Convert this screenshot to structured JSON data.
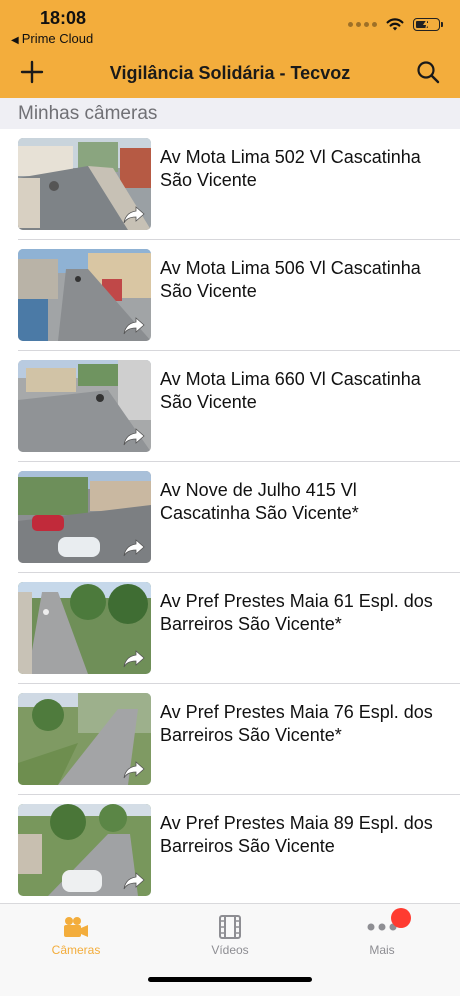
{
  "colors": {
    "accent": "#f3ad3c",
    "badge": "#ff3b30"
  },
  "status_bar": {
    "time": "18:08",
    "back_app": "Prime Cloud"
  },
  "nav": {
    "title": "Vigilância Solidária - Tecvoz",
    "left_icon": "plus-icon",
    "right_icon": "search-icon"
  },
  "section": {
    "header": "Minhas câmeras"
  },
  "cameras": [
    {
      "name": "Av Mota Lima 502 Vl Cascatinha São Vicente"
    },
    {
      "name": "Av Mota Lima 506 Vl Cascatinha São Vicente"
    },
    {
      "name": "Av Mota Lima 660 Vl Cascatinha São Vicente"
    },
    {
      "name": "Av Nove de Julho 415 Vl Cascatinha São Vicente*"
    },
    {
      "name": "Av Pref Prestes Maia 61 Espl. dos Barreiros São Vicente*"
    },
    {
      "name": "Av Pref Prestes Maia 76 Espl. dos Barreiros São Vicente*"
    },
    {
      "name": "Av Pref Prestes Maia 89 Espl. dos Barreiros São Vicente"
    }
  ],
  "tabs": [
    {
      "label": "Câmeras",
      "icon": "video-camera-icon",
      "active": true
    },
    {
      "label": "Vídeos",
      "icon": "film-icon",
      "active": false
    },
    {
      "label": "Mais",
      "icon": "more-dots-icon",
      "active": false,
      "badge": true
    }
  ]
}
